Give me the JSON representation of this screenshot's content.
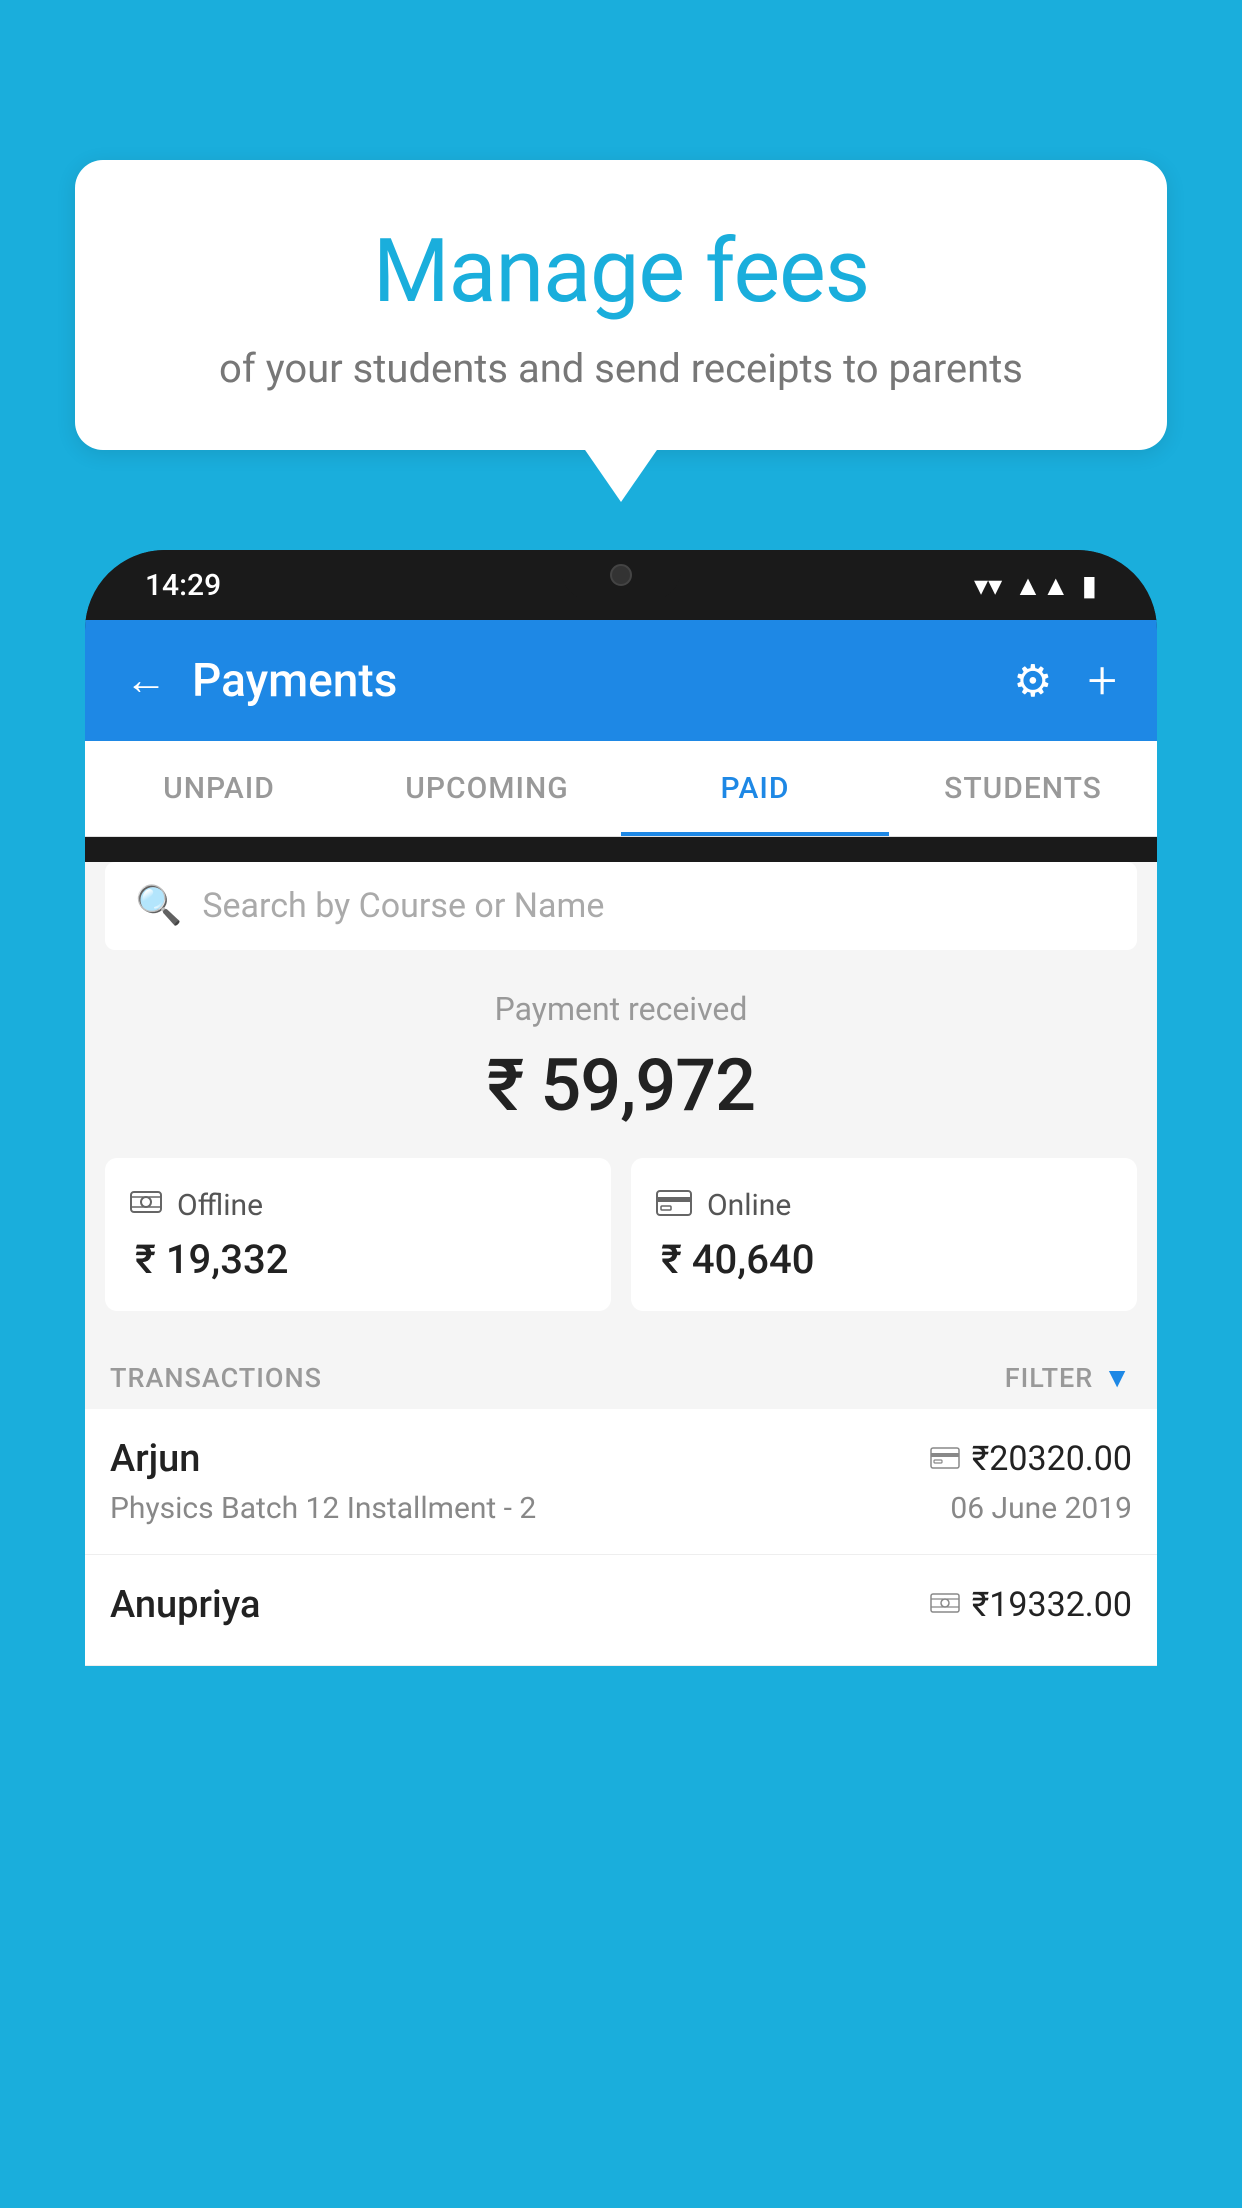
{
  "background": {
    "color": "#1AAEDC"
  },
  "speech_bubble": {
    "title": "Manage fees",
    "subtitle": "of your students and send receipts to parents"
  },
  "phone": {
    "status_bar": {
      "time": "14:29"
    },
    "header": {
      "title": "Payments",
      "back_label": "←",
      "settings_label": "⚙",
      "add_label": "+"
    },
    "tabs": [
      {
        "label": "UNPAID",
        "active": false
      },
      {
        "label": "UPCOMING",
        "active": false
      },
      {
        "label": "PAID",
        "active": true
      },
      {
        "label": "STUDENTS",
        "active": false
      }
    ],
    "search": {
      "placeholder": "Search by Course or Name"
    },
    "payment_received": {
      "label": "Payment received",
      "amount": "₹ 59,972"
    },
    "payment_cards": [
      {
        "icon": "💳",
        "label": "Offline",
        "amount": "₹ 19,332"
      },
      {
        "icon": "💳",
        "label": "Online",
        "amount": "₹ 40,640"
      }
    ],
    "transactions_section": {
      "label": "TRANSACTIONS",
      "filter_label": "FILTER"
    },
    "transactions": [
      {
        "name": "Arjun",
        "course": "Physics Batch 12 Installment - 2",
        "amount": "₹20320.00",
        "date": "06 June 2019",
        "payment_type": "online"
      },
      {
        "name": "Anupriya",
        "course": "",
        "amount": "₹19332.00",
        "date": "",
        "payment_type": "offline"
      }
    ]
  }
}
